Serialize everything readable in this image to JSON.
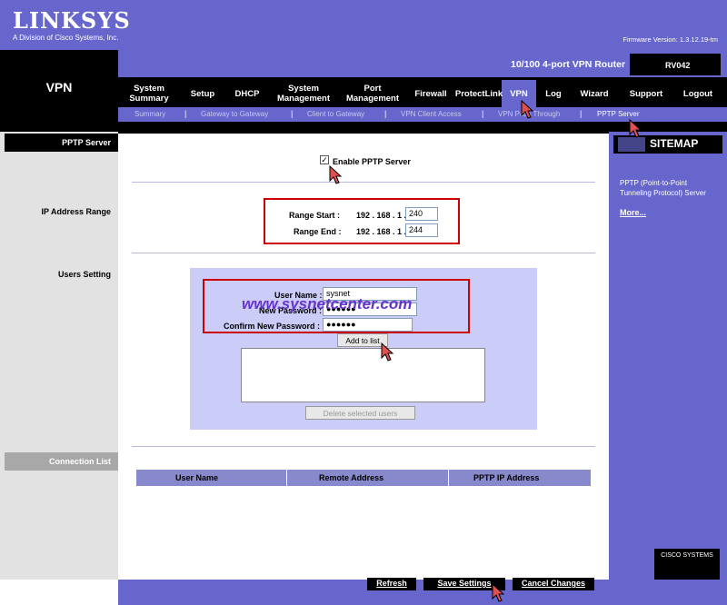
{
  "header": {
    "brand": "LINKSYS",
    "brand_sub": "A Division of Cisco Systems, Inc.",
    "firmware": "Firmware Version: 1.3.12.19-tm",
    "section": "VPN",
    "model_name": "10/100 4-port VPN Router",
    "model_id": "RV042"
  },
  "nav": {
    "items": [
      {
        "line1": "System",
        "line2": "Summary"
      },
      {
        "line1": "Setup",
        "line2": ""
      },
      {
        "line1": "DHCP",
        "line2": ""
      },
      {
        "line1": "System",
        "line2": "Management"
      },
      {
        "line1": "Port",
        "line2": "Management"
      },
      {
        "line1": "Firewall",
        "line2": ""
      },
      {
        "line1": "ProtectLink",
        "line2": ""
      },
      {
        "line1": "VPN",
        "line2": ""
      },
      {
        "line1": "Log",
        "line2": ""
      },
      {
        "line1": "Wizard",
        "line2": ""
      },
      {
        "line1": "Support",
        "line2": ""
      },
      {
        "line1": "Logout",
        "line2": ""
      }
    ],
    "sub": [
      "Summary",
      "Gateway to Gateway",
      "Client to Gateway",
      "VPN Client Access",
      "VPN Pass Through",
      "PPTP Server"
    ]
  },
  "left": {
    "pptp_server": "PPTP Server",
    "ip_range": "IP Address Range",
    "users_setting": "Users Setting",
    "connection_list": "Connection List"
  },
  "form": {
    "enable_label": "Enable PPTP Server",
    "range_start_label": "Range Start :",
    "range_end_label": "Range End :",
    "ip_prefix_start": "192 . 168 . 1 .",
    "ip_prefix_end": "192 . 168 . 1 .",
    "range_start": "240",
    "range_end": "244",
    "user_name_label": "User Name :",
    "user_name": "sysnet",
    "new_password_label": "New Password :",
    "new_password": "●●●●●●",
    "confirm_password_label": "Confirm New Password :",
    "confirm_password": "●●●●●●",
    "add_button": "Add to list",
    "delete_button": "Delete selected users",
    "watermark": "www.sysnetcenter.com"
  },
  "table": {
    "headers": [
      "User Name",
      "Remote Address",
      "PPTP IP Address"
    ]
  },
  "sitemap": {
    "title": "SITEMAP",
    "desc": "PPTP (Point-to-Point Tunneling Protocol) Server",
    "more": "More..."
  },
  "footer": {
    "refresh": "Refresh",
    "save": "Save Settings",
    "cancel": "Cancel Changes",
    "cisco": "CISCO SYSTEMS"
  }
}
